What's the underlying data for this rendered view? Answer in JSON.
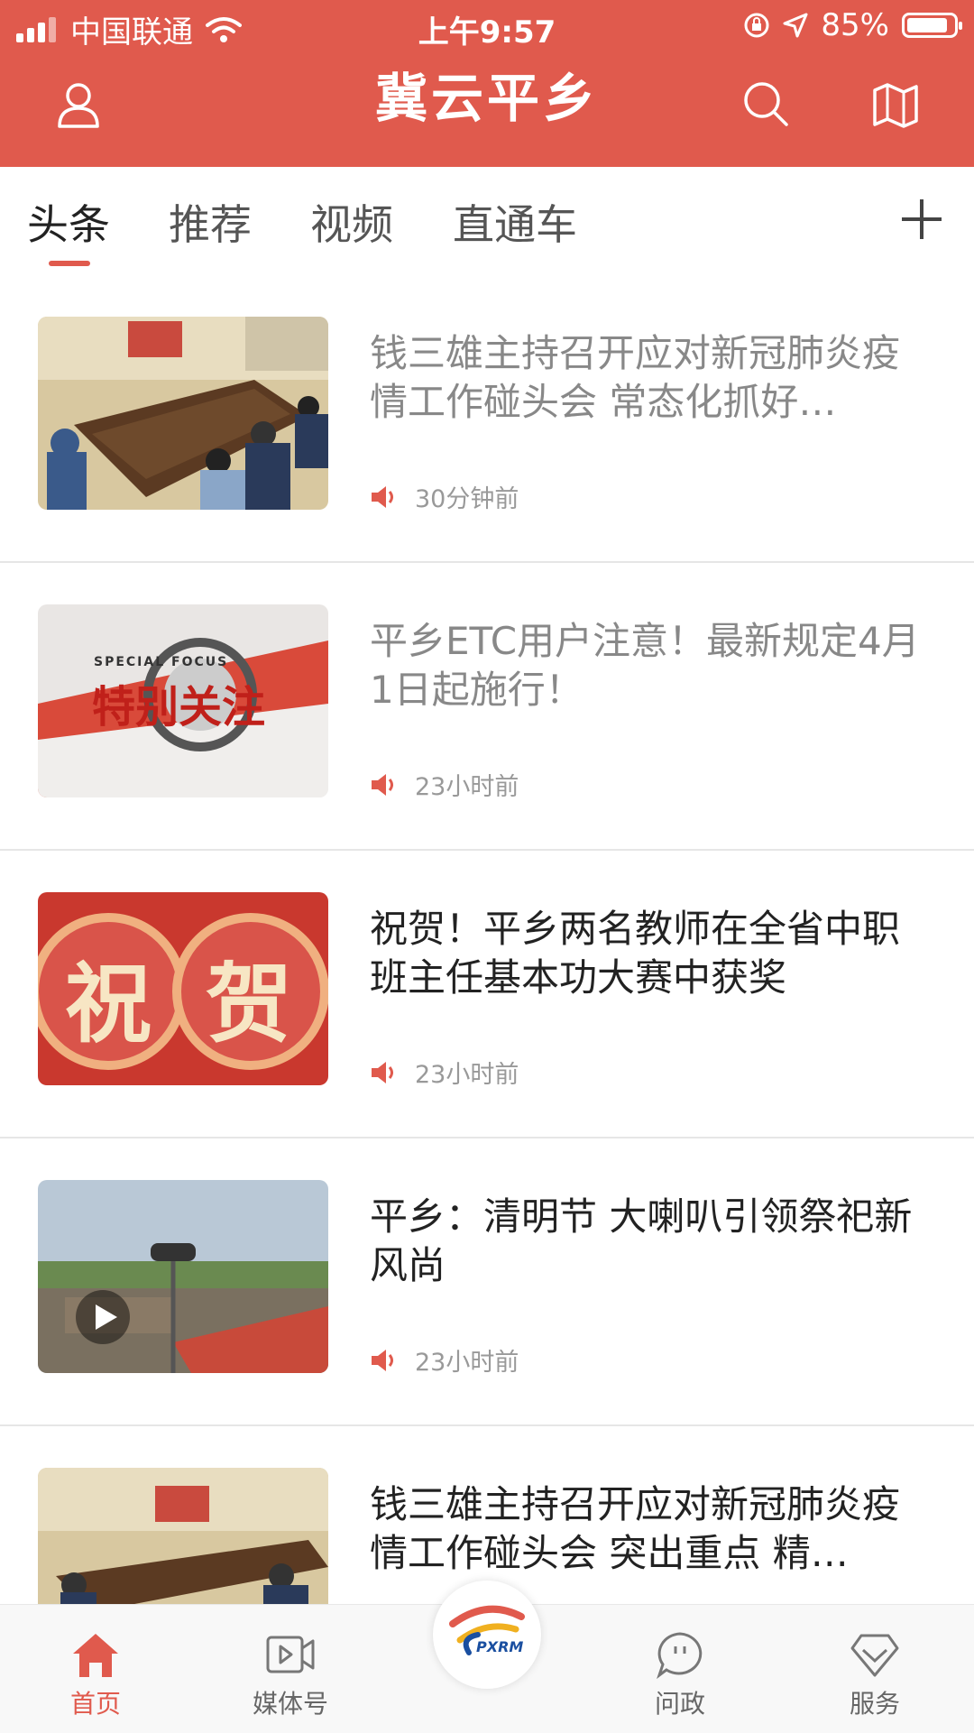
{
  "status_bar": {
    "carrier": "中国联通",
    "time": "上午9:57",
    "battery": "85%"
  },
  "header": {
    "title": "冀云平乡"
  },
  "tabs": [
    {
      "label": "头条",
      "active": true
    },
    {
      "label": "推荐"
    },
    {
      "label": "视频"
    },
    {
      "label": "直通车"
    }
  ],
  "news": [
    {
      "title": "钱三雄主持召开应对新冠肺炎疫情工作碰头会 常态化抓好…",
      "time": "30分钟前",
      "read": true
    },
    {
      "title": "平乡ETC用户注意！最新规定4月1日起施行！",
      "time": "23小时前",
      "read": true,
      "thumb_text": "特别关注",
      "thumb_sub": "SPECIAL FOCUS"
    },
    {
      "title": "祝贺！平乡两名教师在全省中职班主任基本功大赛中获奖",
      "time": "23小时前",
      "read": false,
      "thumb_chars": [
        "祝",
        "贺"
      ]
    },
    {
      "title": "平乡：清明节 大喇叭引领祭祀新风尚",
      "time": "23小时前",
      "read": false,
      "video": true
    },
    {
      "title": "钱三雄主持召开应对新冠肺炎疫情工作碰头会 突出重点 精…",
      "time": "",
      "read": false
    }
  ],
  "bottom_nav": [
    {
      "label": "首页",
      "icon": "home-icon",
      "active": true
    },
    {
      "label": "媒体号",
      "icon": "video-icon"
    },
    {
      "label": "",
      "icon": "pxrm-logo",
      "logo_text": "PXRM"
    },
    {
      "label": "问政",
      "icon": "chat-icon"
    },
    {
      "label": "服务",
      "icon": "diamond-icon"
    }
  ],
  "colors": {
    "brand": "#e05a4d"
  }
}
